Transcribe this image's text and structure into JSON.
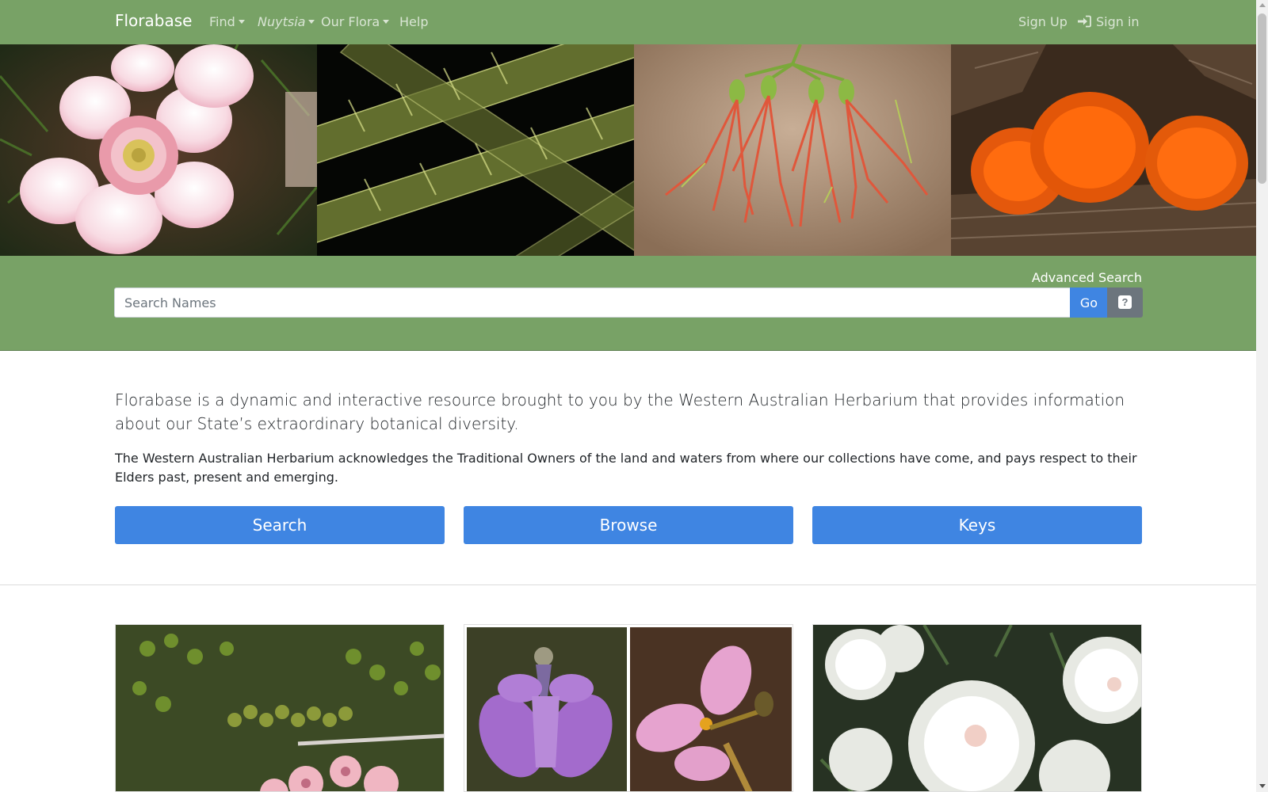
{
  "navbar": {
    "brand": "Florabase",
    "items": [
      {
        "label": "Find",
        "dropdown": true
      },
      {
        "label": "Nuytsia",
        "dropdown": true,
        "italic": true
      },
      {
        "label": "Our Flora",
        "dropdown": true
      },
      {
        "label": "Help",
        "dropdown": false
      }
    ],
    "signup": "Sign Up",
    "signin": "Sign in",
    "signin_icon": "sign-in-icon",
    "color": "#78a266"
  },
  "search": {
    "advanced_label": "Advanced Search",
    "placeholder": "Search Names",
    "value": "",
    "go_label": "Go",
    "help_icon": "question-square-icon",
    "help_glyph": "?"
  },
  "intro": {
    "lead": "Florabase is a dynamic and interactive resource brought to you by the Western Australian Herbarium that provides information about our State’s extraordinary botanical diversity.",
    "acknowledgement": "The Western Australian Herbarium acknowledges the Traditional Owners of the land and waters from where our collections have come, and pays respect to their Elders past, present and emerging."
  },
  "actions": [
    {
      "label": "Search"
    },
    {
      "label": "Browse"
    },
    {
      "label": "Keys"
    }
  ],
  "colors": {
    "accent": "#3f85e2",
    "secondary": "#6c757d"
  }
}
